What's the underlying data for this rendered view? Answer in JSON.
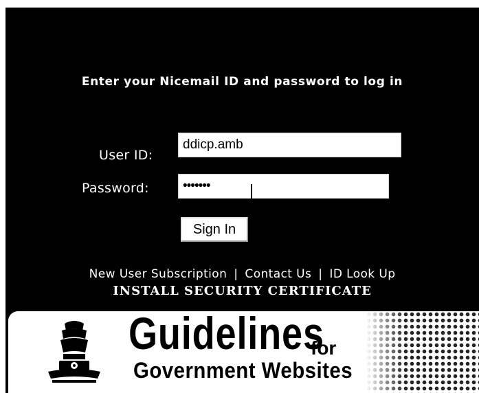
{
  "login": {
    "heading": "Enter your Nicemail ID and password to log in",
    "user_label": "User ID:",
    "user_value": "ddicp.amb",
    "password_label": "Password:",
    "password_value": "•••••••",
    "signin_label": "Sign In"
  },
  "links": {
    "new_user": "New User Subscription",
    "contact": "Contact Us",
    "lookup": "ID Look Up",
    "separator": "|",
    "certificate": "INSTALL SECURITY CERTIFICATE"
  },
  "banner": {
    "title": "Guidelines",
    "for_text": "for",
    "subtitle": "Government Websites",
    "emblem_icon": "state-emblem-icon"
  },
  "colors": {
    "background": "#000000",
    "text": "#ffffff",
    "banner_bg": "#ffffff"
  }
}
